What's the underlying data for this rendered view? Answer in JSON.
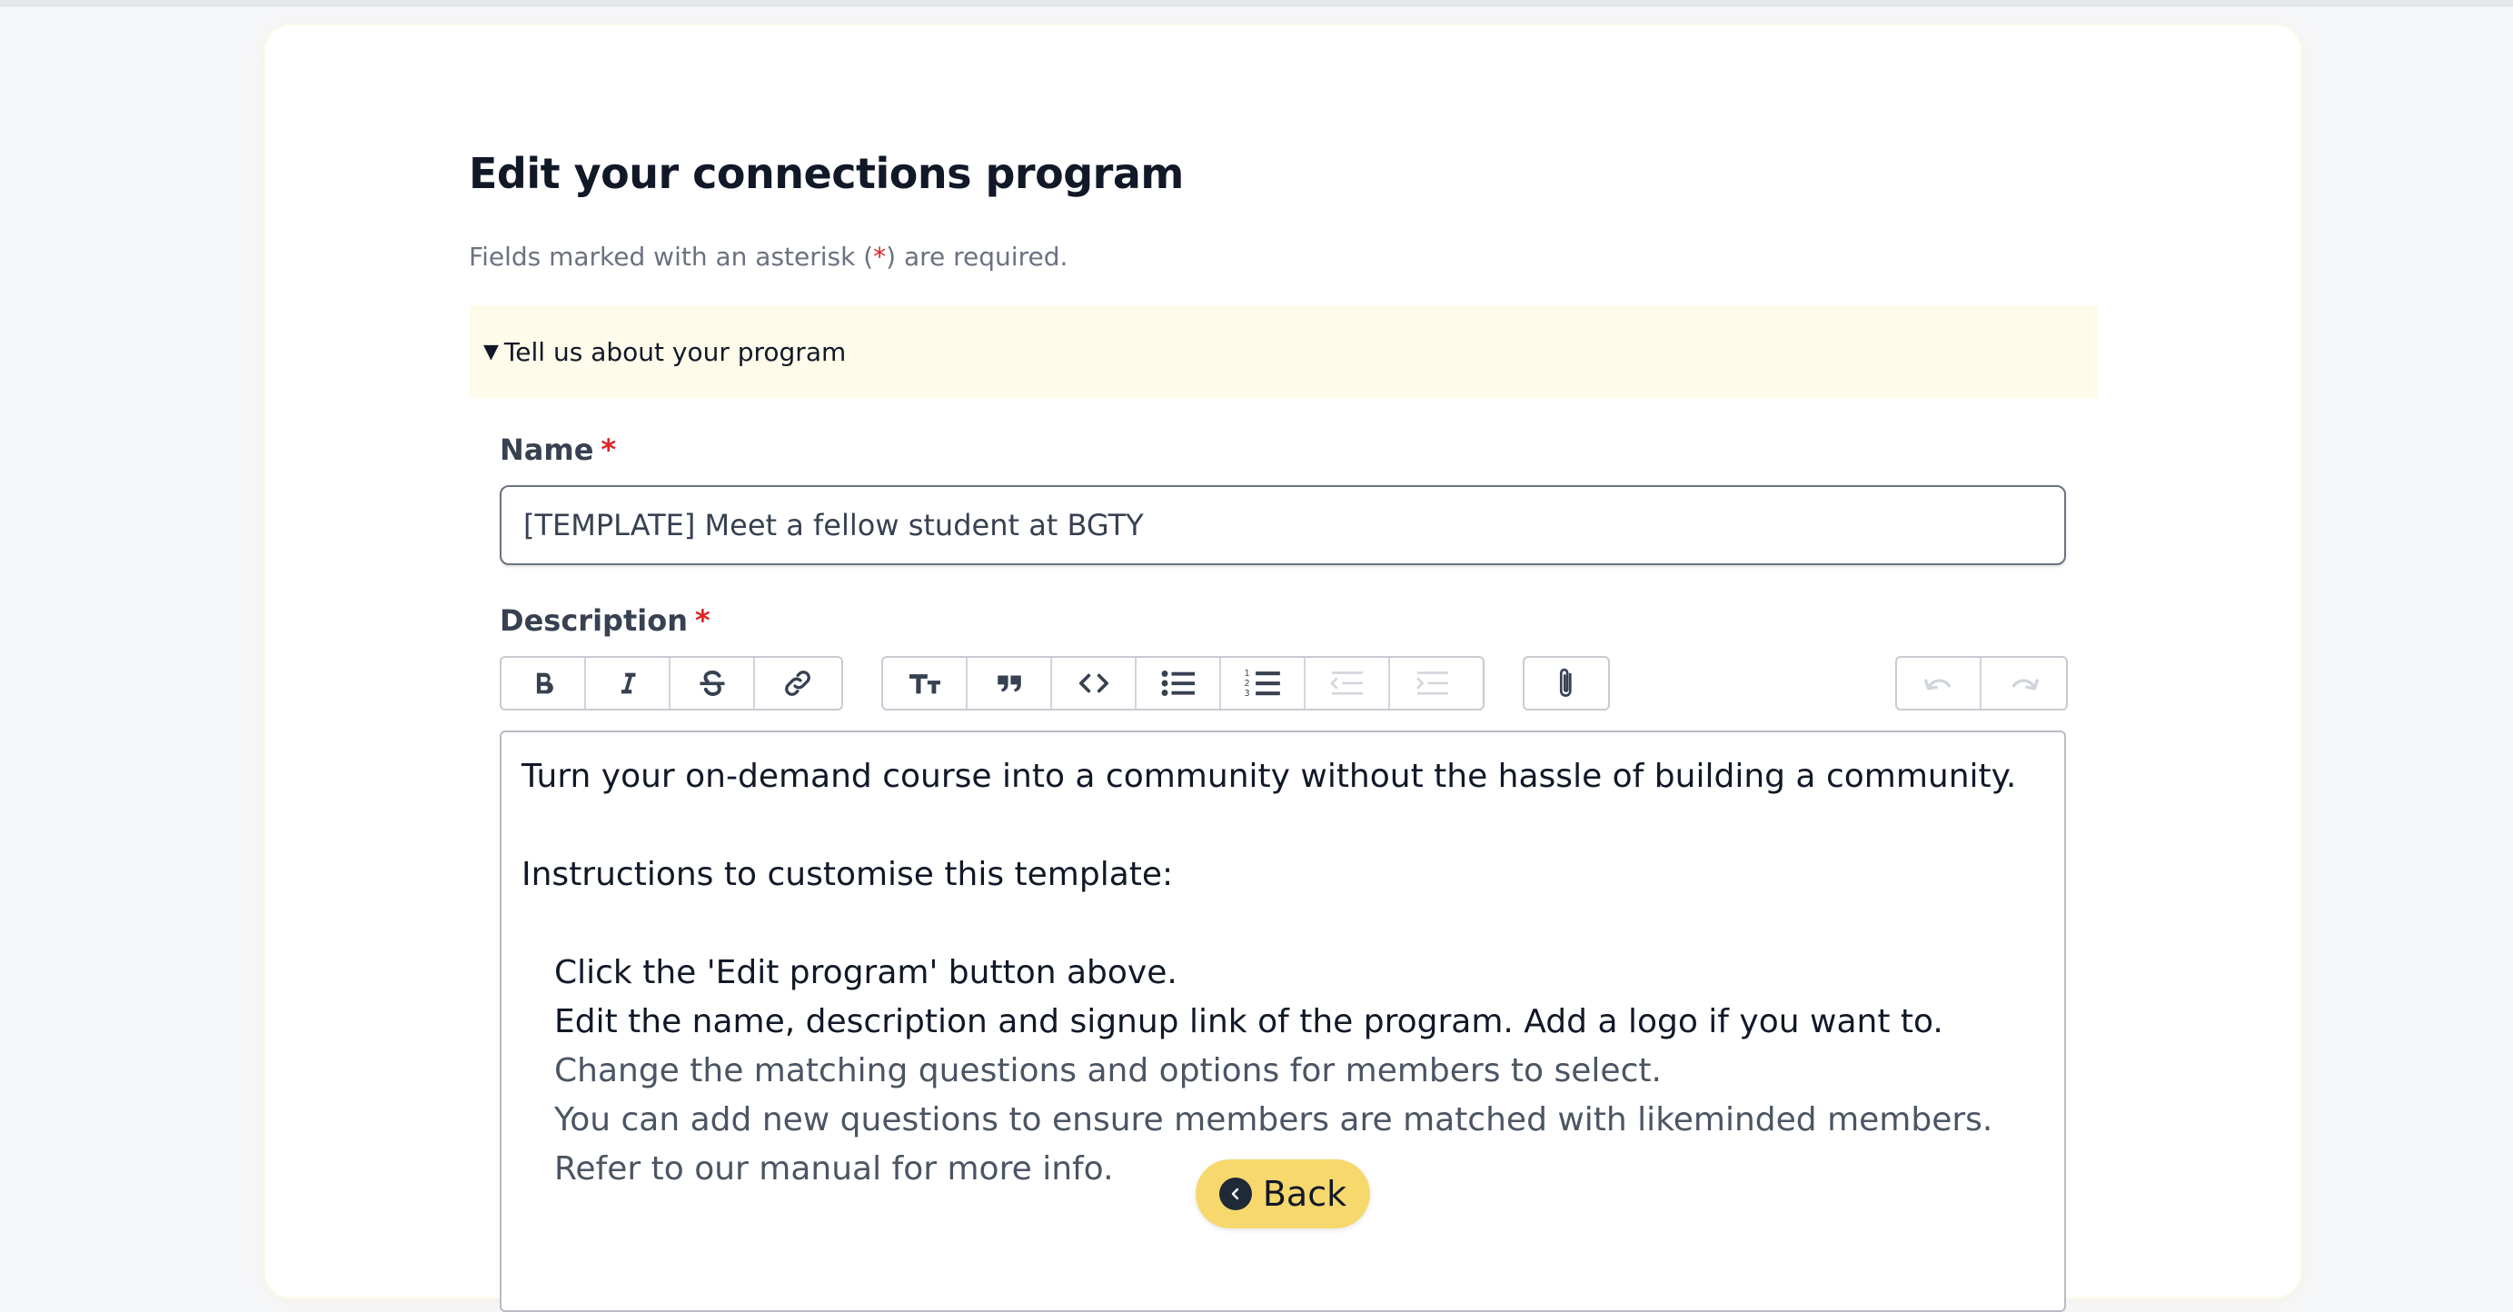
{
  "page": {
    "title": "Edit your connections program",
    "required_note_prefix": "Fields marked with an asterisk (",
    "required_note_asterisk": "*",
    "required_note_suffix": ") are required."
  },
  "section": {
    "toggle_icon": "caret-down-icon",
    "label": "Tell us about your program"
  },
  "name_field": {
    "label": "Name",
    "asterisk": "*",
    "value": "[TEMPLATE] Meet a fellow student at BGTY"
  },
  "description_field": {
    "label": "Description",
    "asterisk": "*"
  },
  "toolbar": {
    "formatting": [
      "bold-icon",
      "italic-icon",
      "strikethrough-icon",
      "link-icon"
    ],
    "blocks": [
      "heading-icon",
      "quote-icon",
      "code-icon",
      "bullet-list-icon",
      "numbered-list-icon",
      "decrease-indent-icon",
      "increase-indent-icon"
    ],
    "attach": [
      "attachment-icon"
    ],
    "history": [
      "undo-icon",
      "redo-icon"
    ]
  },
  "editor": {
    "intro": "Turn your on-demand course into a community without the hassle of building a community.",
    "instructions_heading": "Instructions to customise this template:",
    "steps": [
      "Click the 'Edit program' button above.",
      "Edit the name, description and signup link of the program. Add a logo if you want to.",
      "Change the matching questions and options for members to select.",
      "You can add new questions to ensure members are matched with likeminded members.",
      "Refer to our manual for more info."
    ]
  },
  "back_button": {
    "label": "Back",
    "icon": "chevron-left-icon",
    "background": "#f7d86d"
  }
}
